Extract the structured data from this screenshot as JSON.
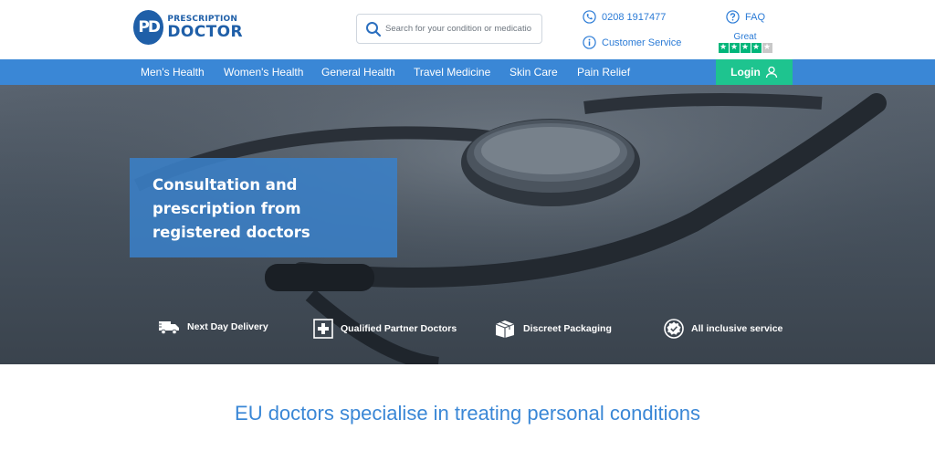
{
  "brand": {
    "logo_mark": "PD",
    "name_top": "PRESCRIPTION",
    "name_bottom": "DOCTOR"
  },
  "search": {
    "placeholder": "Search for your condition or medication",
    "icon": "search-icon"
  },
  "contact": {
    "phone": "0208 1917477",
    "customer_service": "Customer Service",
    "faq": "FAQ"
  },
  "trustpilot": {
    "label": "Great",
    "rating_stars": 4,
    "max_stars": 5,
    "star_color": "#00b67a"
  },
  "nav": {
    "items": [
      {
        "label": "Men's Health"
      },
      {
        "label": "Women's Health"
      },
      {
        "label": "General Health"
      },
      {
        "label": "Travel Medicine"
      },
      {
        "label": "Skin Care"
      },
      {
        "label": "Pain Relief"
      }
    ],
    "login_label": "Login"
  },
  "hero": {
    "title": "Consultation and prescription from registered doctors",
    "features": [
      {
        "label": "Next Day Delivery",
        "icon": "delivery-truck-icon"
      },
      {
        "label": "Qualified Partner Doctors",
        "icon": "medical-cross-icon"
      },
      {
        "label": "Discreet Packaging",
        "icon": "package-box-icon"
      },
      {
        "label": "All inclusive service",
        "icon": "badge-check-icon"
      }
    ]
  },
  "tagline": "EU doctors specialise in treating personal conditions",
  "colors": {
    "brand_blue": "#1f5fa8",
    "nav_blue": "#3a87d6",
    "login_green": "#1ec48f",
    "link_blue": "#2b7bd6"
  }
}
